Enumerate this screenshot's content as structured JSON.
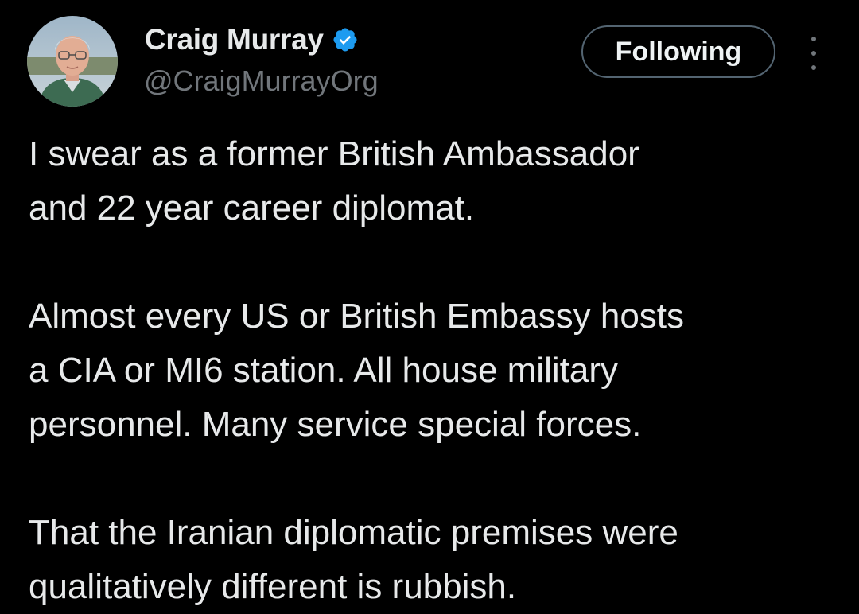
{
  "author": {
    "name": "Craig Murray",
    "handle": "@CraigMurrayOrg",
    "verified": true,
    "avatar_icon": "profile-photo"
  },
  "actions": {
    "follow_label": "Following",
    "more_icon": "ellipsis-vertical-icon"
  },
  "tweet": {
    "paragraphs": [
      "I swear as a former British Ambassador\nand 22 year career diplomat.",
      "Almost every US or British Embassy hosts\na CIA or MI6 station. All house military\npersonnel.  Many service special forces.",
      "That the Iranian diplomatic premises were\nqualitatively different is rubbish."
    ]
  },
  "colors": {
    "background": "#000000",
    "text_primary": "#e7e9ea",
    "text_secondary": "#71767b",
    "verified": "#1d9bf0",
    "button_border": "#536471"
  }
}
